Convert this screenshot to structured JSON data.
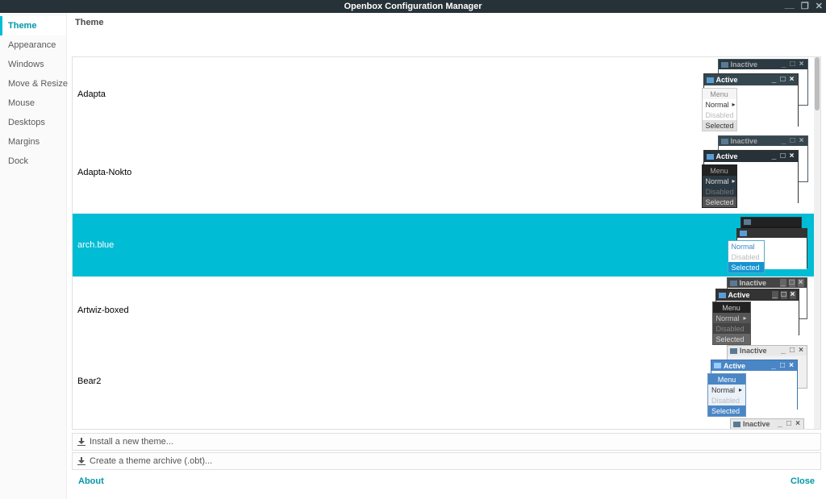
{
  "window": {
    "title": "Openbox Configuration Manager"
  },
  "sidebar": {
    "tabs": [
      {
        "label": "Theme",
        "selected": true
      },
      {
        "label": "Appearance"
      },
      {
        "label": "Windows"
      },
      {
        "label": "Move & Resize"
      },
      {
        "label": "Mouse"
      },
      {
        "label": "Desktops"
      },
      {
        "label": "Margins"
      },
      {
        "label": "Dock"
      }
    ]
  },
  "panel": {
    "title": "Theme"
  },
  "themes": {
    "items": [
      {
        "name": "Adapta",
        "selected": false
      },
      {
        "name": "Adapta-Nokto",
        "selected": false
      },
      {
        "name": "arch.blue",
        "selected": true
      },
      {
        "name": "Artwiz-boxed",
        "selected": false
      },
      {
        "name": "Bear2",
        "selected": false
      }
    ]
  },
  "preview_labels": {
    "inactive": "Inactive",
    "active": "Active",
    "menu": "Menu",
    "normal": "Normal",
    "disabled": "Disabled",
    "selected": "Selected"
  },
  "actions": {
    "install": "Install a new theme...",
    "archive": "Create a theme archive (.obt)..."
  },
  "footer": {
    "about": "About",
    "close": "Close"
  }
}
